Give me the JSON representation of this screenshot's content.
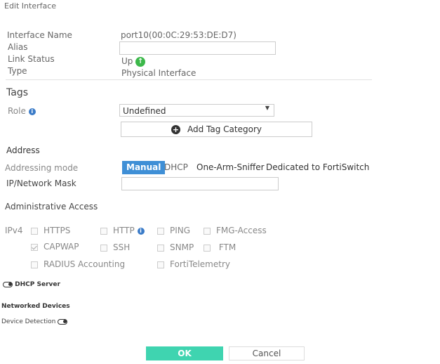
{
  "title": "Edit Interface",
  "fields": {
    "interface_name_label": "Interface Name",
    "interface_name": "port10(00:0C:29:53:DE:D7)",
    "alias_label": "Alias",
    "alias_value": "",
    "link_status_label": "Link Status",
    "link_status": "Up",
    "type_label": "Type",
    "type": "Physical Interface"
  },
  "tags": {
    "heading": "Tags",
    "role_label": "Role",
    "role_value": "Undefined",
    "add_tag_label": "Add Tag Category"
  },
  "address": {
    "heading": "Address",
    "mode_label": "Addressing mode",
    "modes": [
      "Manual",
      "DHCP",
      "One-Arm-Sniffer",
      "Dedicated to FortiSwitch"
    ],
    "selected_mode": "Manual",
    "ip_label": "IP/Network Mask",
    "ip_value": ""
  },
  "admin": {
    "heading": "Administrative Access",
    "ipv4_label": "IPv4",
    "options": [
      {
        "label": "HTTPS",
        "checked": false
      },
      {
        "label": "HTTP",
        "checked": false
      },
      {
        "label": "PING",
        "checked": false
      },
      {
        "label": "FMG-Access",
        "checked": false
      },
      {
        "label": "CAPWAP",
        "checked": true
      },
      {
        "label": "SSH",
        "checked": false
      },
      {
        "label": "SNMP",
        "checked": false
      },
      {
        "label": "FTM",
        "checked": false
      },
      {
        "label": "RADIUS Accounting",
        "checked": false
      },
      {
        "label": "FortiTelemetry",
        "checked": false
      }
    ]
  },
  "dhcp_server_label": "DHCP Server",
  "networked_devices": {
    "heading": "Networked Devices",
    "device_detection_label": "Device Detection"
  },
  "buttons": {
    "ok": "OK",
    "cancel": "Cancel"
  },
  "colors": {
    "accent": "#3f8fd6",
    "ok": "#3fd4b0",
    "status_up": "#3cb84a"
  }
}
